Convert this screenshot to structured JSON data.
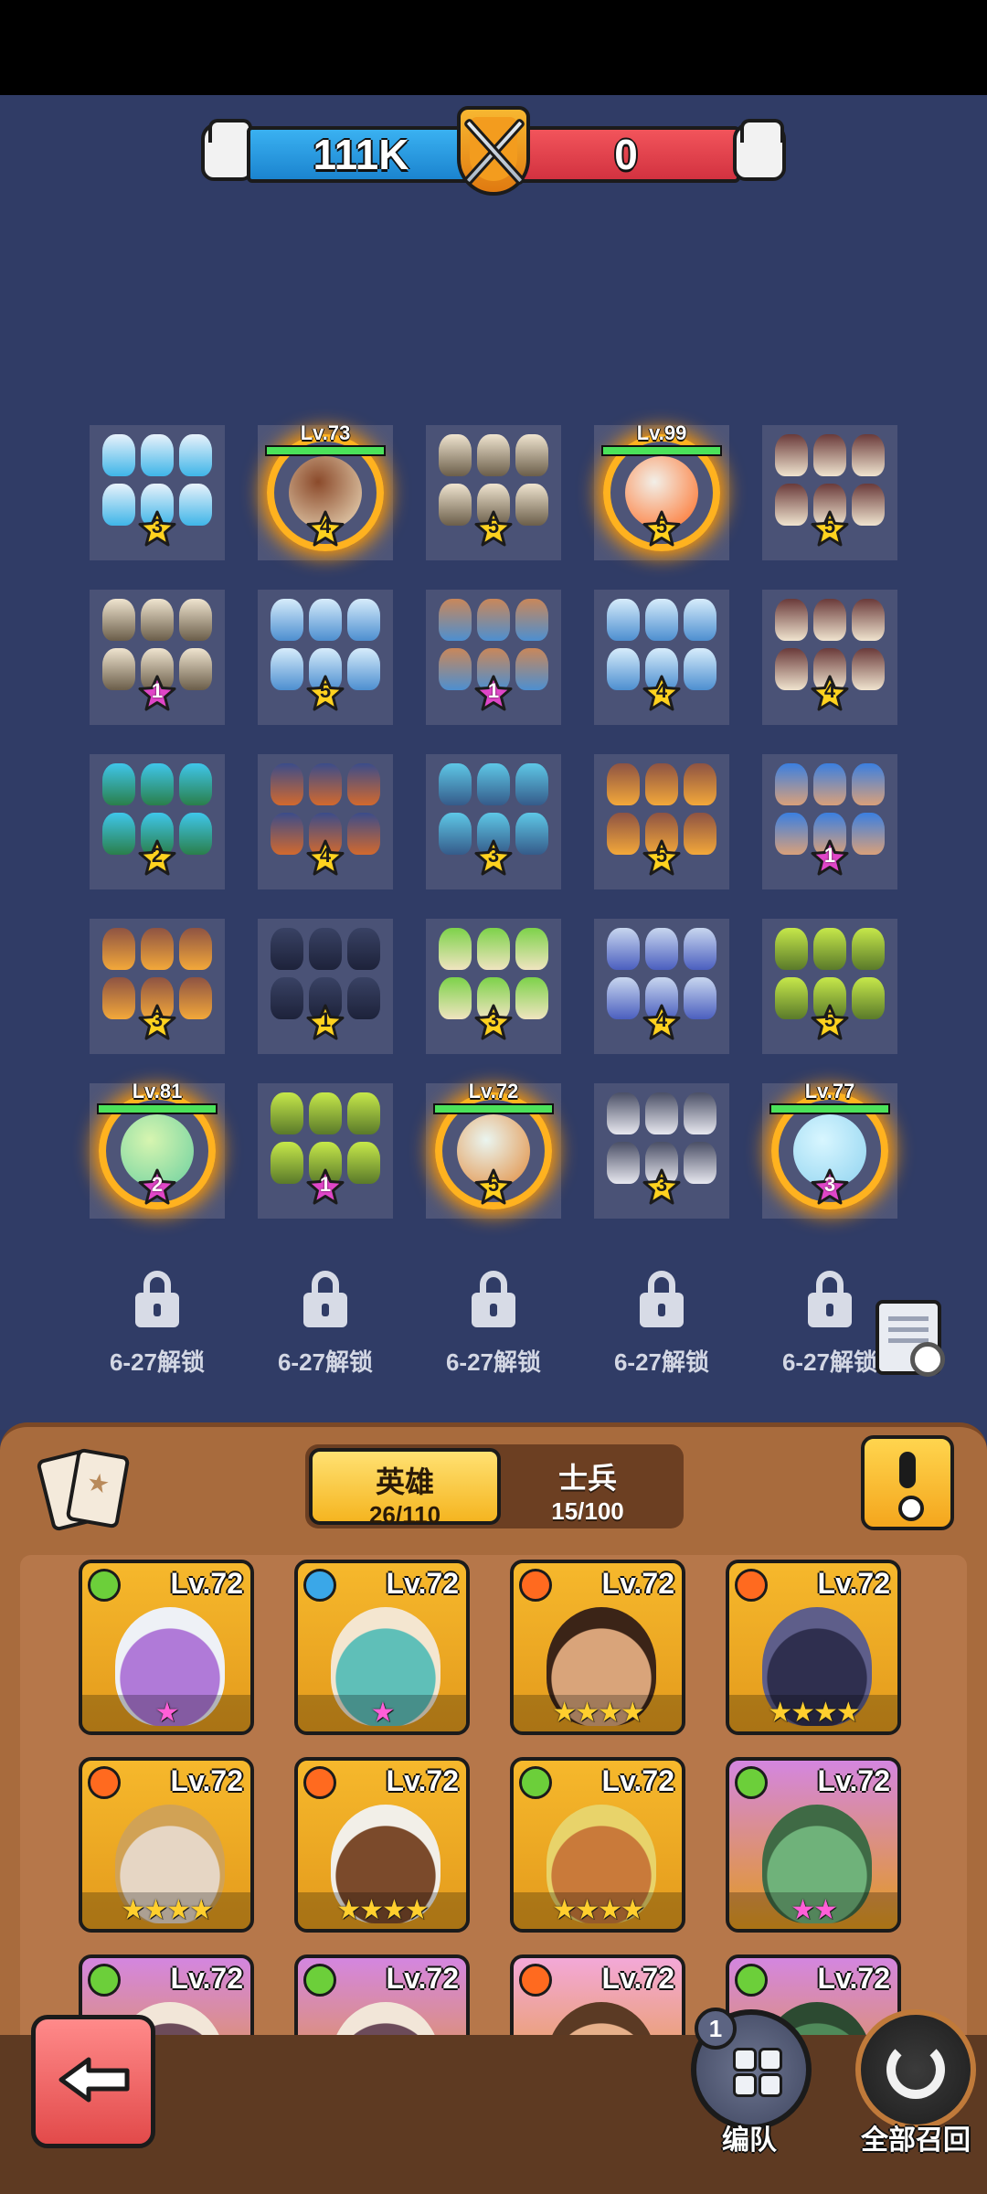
{
  "power_bar": {
    "player_power": "111K",
    "enemy_power": "0",
    "player_color": "#2192dc",
    "enemy_color": "#e43f4c"
  },
  "board": {
    "rows": [
      [
        {
          "unit": "ice-bird-soldiers",
          "stars": 3,
          "hero": false
        },
        {
          "unit": "berserker-hero",
          "stars": 4,
          "hero": true,
          "level": "Lv.73",
          "hp": 1.0
        },
        {
          "unit": "skeleton-squid",
          "stars": 5,
          "hero": false
        },
        {
          "unit": "flame-blade-hero",
          "stars": 5,
          "hero": true,
          "level": "Lv.99",
          "hp": 1.0
        },
        {
          "unit": "spear-warriors",
          "stars": 5,
          "hero": false
        }
      ],
      [
        {
          "unit": "skeleton-squid",
          "stars": 1,
          "hero": false,
          "star_color": "pink"
        },
        {
          "unit": "ice-lancers",
          "stars": 5,
          "hero": false
        },
        {
          "unit": "spear-pikemen",
          "stars": 1,
          "hero": false,
          "star_color": "pink"
        },
        {
          "unit": "ice-lancers",
          "stars": 4,
          "hero": false
        },
        {
          "unit": "spear-warriors",
          "stars": 4,
          "hero": false
        }
      ],
      [
        {
          "unit": "blue-flower-plant",
          "stars": 2,
          "hero": false
        },
        {
          "unit": "club-brutes",
          "stars": 4,
          "hero": false
        },
        {
          "unit": "ice-crab",
          "stars": 3,
          "hero": false
        },
        {
          "unit": "fist-spiked-mace",
          "stars": 5,
          "hero": false
        },
        {
          "unit": "shield-blocks",
          "stars": 1,
          "hero": false,
          "star_color": "pink"
        }
      ],
      [
        {
          "unit": "fist-spiked-mace",
          "stars": 3,
          "hero": false
        },
        {
          "unit": "rat-scouts",
          "stars": 1,
          "hero": false
        },
        {
          "unit": "green-cloak-shaman",
          "stars": 3,
          "hero": false
        },
        {
          "unit": "tail-beast",
          "stars": 4,
          "hero": false
        },
        {
          "unit": "green-spiked-shields",
          "stars": 5,
          "hero": false
        }
      ],
      [
        {
          "unit": "forest-fairy-hero",
          "stars": 2,
          "hero": true,
          "level": "Lv.81",
          "hp": 1.0,
          "star_color": "pink"
        },
        {
          "unit": "green-spiked-shields",
          "stars": 1,
          "hero": false,
          "star_color": "pink"
        },
        {
          "unit": "bomber-hero",
          "stars": 5,
          "hero": true,
          "level": "Lv.72",
          "hp": 1.0
        },
        {
          "unit": "siege-catapult",
          "stars": 3,
          "hero": false
        },
        {
          "unit": "ice-mage-hero",
          "stars": 3,
          "hero": true,
          "level": "Lv.77",
          "hp": 1.0,
          "star_color": "pink"
        }
      ]
    ],
    "locked_slots": [
      "6-27解锁",
      "6-27解锁",
      "6-27解锁",
      "6-27解锁",
      "6-27解锁"
    ]
  },
  "panel": {
    "tabs": [
      {
        "label": "英雄",
        "count": "26/110",
        "active": true
      },
      {
        "label": "士兵",
        "count": "15/100",
        "active": false
      }
    ]
  },
  "hero_cards": [
    {
      "level": "Lv.72",
      "element": "leaf-icon",
      "stars": 1,
      "star_color": "pink",
      "bg": "#f6b82c",
      "face": "#b07ad8",
      "hair": "#eef1f6"
    },
    {
      "level": "Lv.72",
      "element": "water-icon",
      "stars": 1,
      "star_color": "pink",
      "bg": "#f6b82c",
      "face": "#5fbfb8",
      "hair": "#f4e6d0"
    },
    {
      "level": "Lv.72",
      "element": "fire-icon",
      "stars": 4,
      "star_color": "gold",
      "bg": "#f6b82c",
      "face": "#d9a47a",
      "hair": "#3b2417"
    },
    {
      "level": "Lv.72",
      "element": "fire-icon",
      "stars": 4,
      "star_color": "gold",
      "bg": "#f6b82c",
      "face": "#2f2f4f",
      "hair": "#5e5e8a"
    },
    {
      "level": "Lv.72",
      "element": "fire-icon",
      "stars": 4,
      "star_color": "gold",
      "bg": "#f6b82c",
      "face": "#e6d6c4",
      "hair": "#d1a255"
    },
    {
      "level": "Lv.72",
      "element": "fire-icon",
      "stars": 4,
      "star_color": "gold",
      "bg": "#f6b82c",
      "face": "#7b4a2b",
      "hair": "#f2efe8"
    },
    {
      "level": "Lv.72",
      "element": "leaf-icon",
      "stars": 4,
      "star_color": "gold",
      "bg": "#f6b82c",
      "face": "#c97a3a",
      "hair": "#e8d36a"
    },
    {
      "level": "Lv.72",
      "element": "leaf-icon",
      "stars": 2,
      "star_color": "pink",
      "bg": "#d486e0",
      "face": "#6fb27a",
      "hair": "#3f6a45"
    },
    {
      "level": "Lv.72",
      "element": "leaf-icon",
      "stars": 0,
      "star_color": "gold",
      "bg": "#d486e0",
      "face": "#6c4b5a",
      "hair": "#f2e6d8"
    },
    {
      "level": "Lv.72",
      "element": "leaf-icon",
      "stars": 0,
      "star_color": "gold",
      "bg": "#d486e0",
      "face": "#6c4b5a",
      "hair": "#f2e6d8"
    },
    {
      "level": "Lv.72",
      "element": "fire-icon",
      "stars": 0,
      "star_color": "gold",
      "bg": "#f3a8d8",
      "face": "#e7b08a",
      "hair": "#5b3a24"
    },
    {
      "level": "Lv.72",
      "element": "leaf-icon",
      "stars": 0,
      "star_color": "gold",
      "bg": "#d486e0",
      "face": "#4f8a5a",
      "hair": "#2c4a31"
    }
  ],
  "bottom_bar": {
    "team_badge": "1",
    "team_label": "编队",
    "recall_label": "全部召回"
  }
}
